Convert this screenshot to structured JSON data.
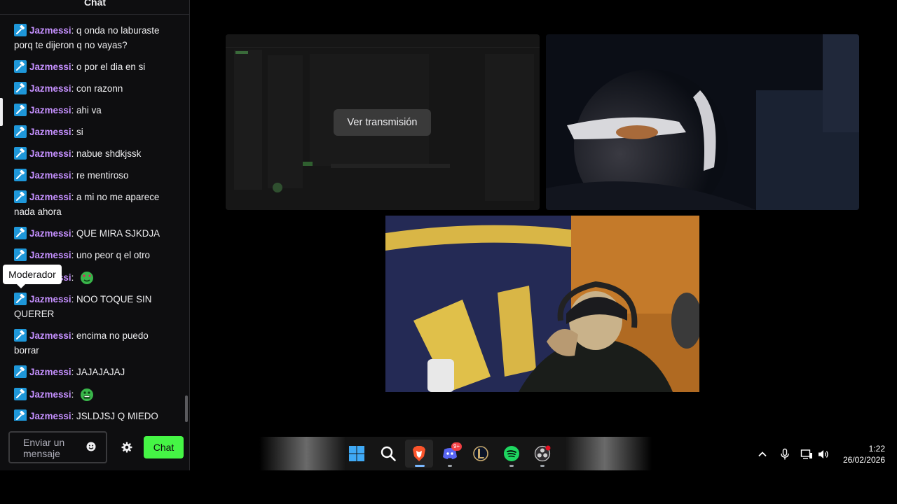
{
  "chat": {
    "title": "Chat",
    "messages": [
      {
        "user": "Jazmessi",
        "text": "q onda no laburaste porq te dijeron q no vayas?"
      },
      {
        "user": "Jazmessi",
        "text": "o por el dia en si"
      },
      {
        "user": "Jazmessi",
        "text": "con razonn"
      },
      {
        "user": "Jazmessi",
        "text": "ahi va"
      },
      {
        "user": "Jazmessi",
        "text": "si"
      },
      {
        "user": "Jazmessi",
        "text": "nabue shdkjssk"
      },
      {
        "user": "Jazmessi",
        "text": "re mentiroso"
      },
      {
        "user": "Jazmessi",
        "text": "a mi no me aparece nada ahora"
      },
      {
        "user": "Jazmessi",
        "text": "QUE MIRA SJKDJA"
      },
      {
        "user": "Jazmessi",
        "text": "uno peor q el otro"
      },
      {
        "user": "Jazmessi",
        "text": "",
        "emote": "green-heart-eyes-emote"
      },
      {
        "user": "Jazmessi",
        "text": "NOO TOQUE SIN QUERER"
      },
      {
        "user": "Jazmessi",
        "text": "encima no puedo borrar"
      },
      {
        "user": "Jazmessi",
        "text": "JAJAJAJAJ"
      },
      {
        "user": "Jazmessi",
        "text": "",
        "emote": "green-scared-emote"
      },
      {
        "user": "Jazmessi",
        "text": "JSLDJSJ Q MIEDO"
      }
    ],
    "badge_tooltip": "Moderador",
    "input_placeholder": "Enviar un mensaje",
    "send_label": "Chat",
    "colors": {
      "username": "#c590ff",
      "badge": "#1e97d9",
      "send": "#45f545"
    }
  },
  "stream": {
    "watch_button": "Ver transmisión"
  },
  "taskbar": {
    "apps": [
      "windows-start-icon",
      "search-icon",
      "brave-browser-icon",
      "discord-icon",
      "league-of-legends-icon",
      "spotify-icon",
      "obs-icon"
    ],
    "discord_badge": "9+",
    "tray": [
      "chevron-up-icon",
      "microphone-icon",
      "network-icon",
      "speaker-icon"
    ],
    "time": "1:22",
    "date": "26/02/2026"
  }
}
